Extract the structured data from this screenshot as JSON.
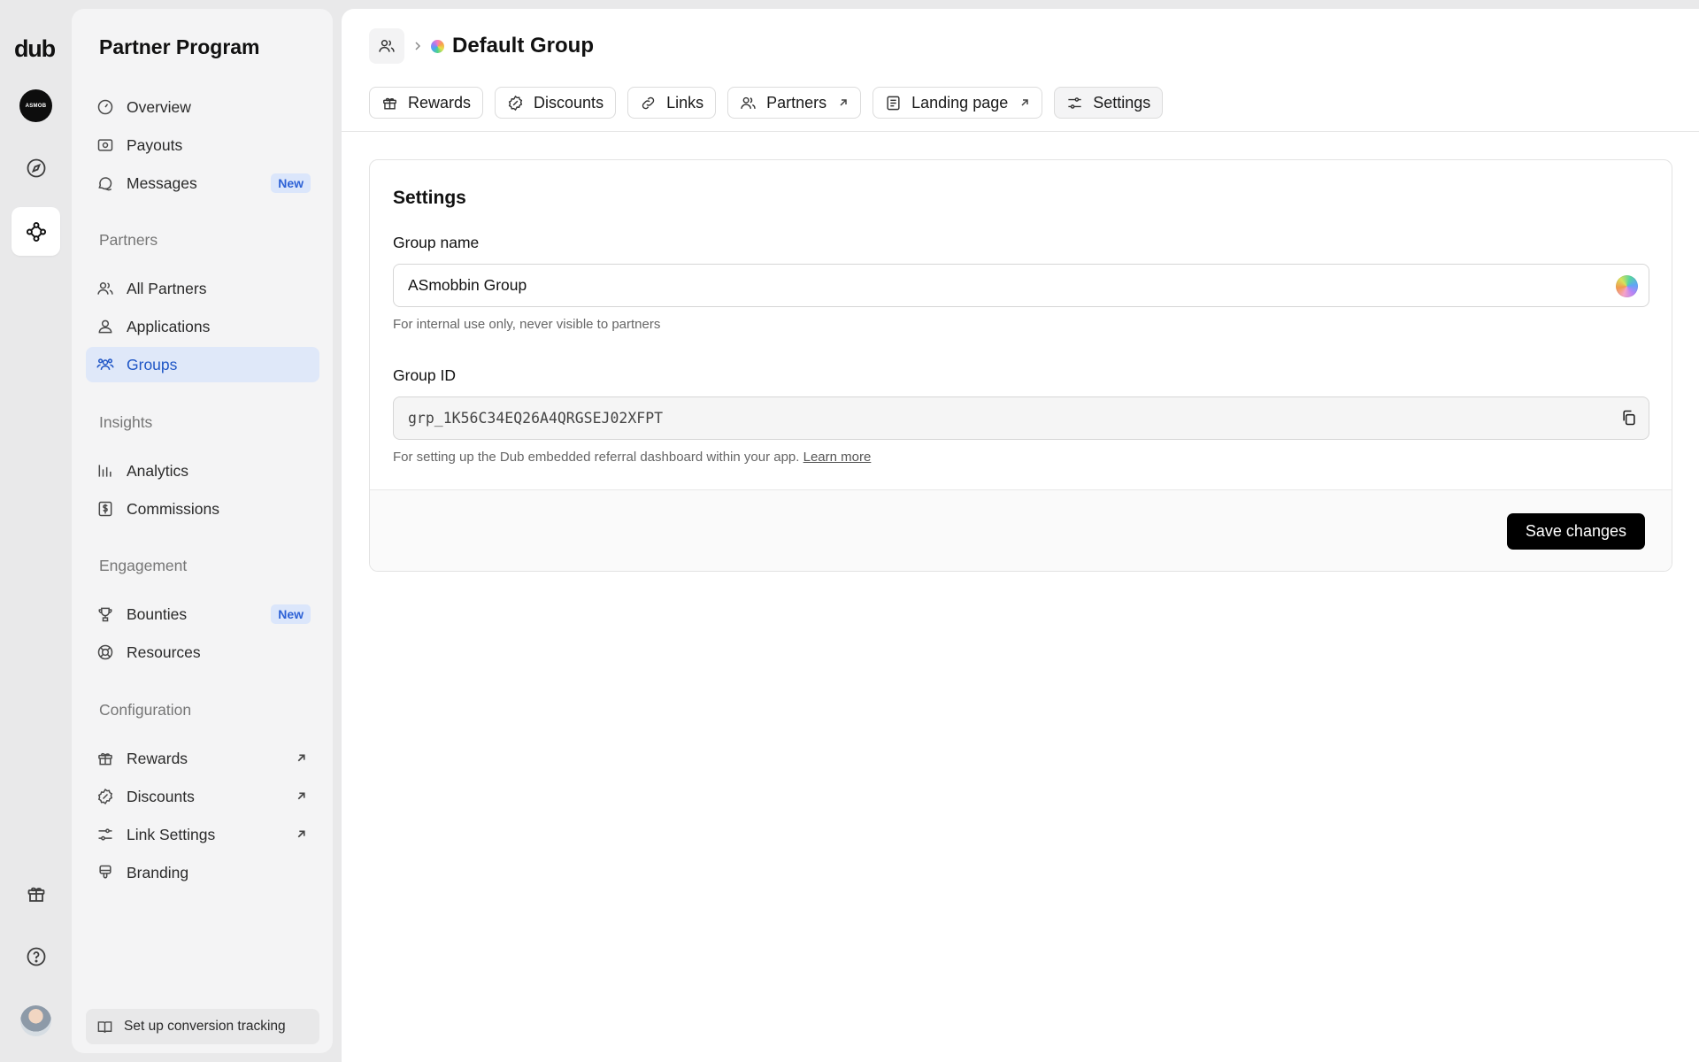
{
  "rail": {
    "logo": "dub",
    "workspace_initials": "ASMOB"
  },
  "sidebar": {
    "title": "Partner Program",
    "top_items": [
      {
        "label": "Overview",
        "icon": "gauge-icon"
      },
      {
        "label": "Payouts",
        "icon": "money-icon"
      },
      {
        "label": "Messages",
        "icon": "chat-icon",
        "badge": "New"
      }
    ],
    "sections": {
      "partners": "Partners",
      "insights": "Insights",
      "engagement": "Engagement",
      "configuration": "Configuration"
    },
    "partners_items": [
      {
        "label": "All Partners",
        "icon": "users-icon"
      },
      {
        "label": "Applications",
        "icon": "user-icon"
      },
      {
        "label": "Groups",
        "icon": "users-group-icon",
        "active": true
      }
    ],
    "insights_items": [
      {
        "label": "Analytics",
        "icon": "bar-chart-icon"
      },
      {
        "label": "Commissions",
        "icon": "dollar-invoice-icon"
      }
    ],
    "engagement_items": [
      {
        "label": "Bounties",
        "icon": "trophy-icon",
        "badge": "New"
      },
      {
        "label": "Resources",
        "icon": "lifebuoy-icon"
      }
    ],
    "configuration_items": [
      {
        "label": "Rewards",
        "icon": "gift-icon",
        "external": true
      },
      {
        "label": "Discounts",
        "icon": "discount-icon",
        "external": true
      },
      {
        "label": "Link Settings",
        "icon": "sliders-icon",
        "external": true
      },
      {
        "label": "Branding",
        "icon": "paintbrush-icon"
      }
    ],
    "bottom_cta": "Set up conversion tracking"
  },
  "header": {
    "title": "Default Group"
  },
  "tabs": [
    {
      "label": "Rewards",
      "icon": "gift-icon"
    },
    {
      "label": "Discounts",
      "icon": "discount-icon"
    },
    {
      "label": "Links",
      "icon": "link-icon"
    },
    {
      "label": "Partners",
      "icon": "users-icon",
      "external": true
    },
    {
      "label": "Landing page",
      "icon": "page-icon",
      "external": true
    },
    {
      "label": "Settings",
      "icon": "sliders-icon",
      "active": true
    }
  ],
  "settings": {
    "title": "Settings",
    "group_name_label": "Group name",
    "group_name_value": "ASmobbin Group",
    "group_name_help": "For internal use only, never visible to partners",
    "group_id_label": "Group ID",
    "group_id_value": "grp_1K56C34EQ26A4QRGSEJ02XFPT",
    "group_id_help": "For setting up the Dub embedded referral dashboard within your app.",
    "learn_more": "Learn more",
    "save_label": "Save changes"
  }
}
